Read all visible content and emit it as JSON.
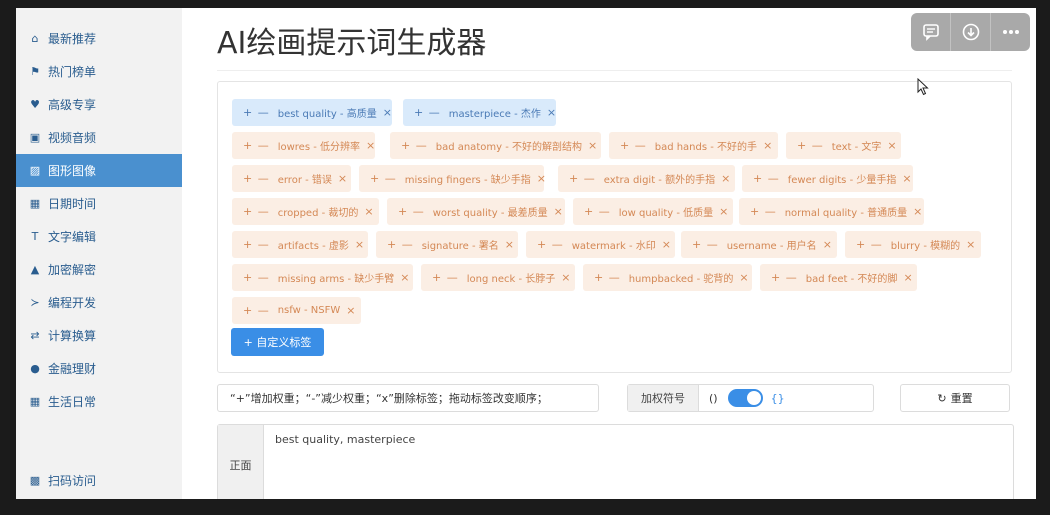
{
  "sidebar": {
    "items": [
      {
        "label": "最新推荐",
        "icon": "home-icon",
        "glyph": "⌂"
      },
      {
        "label": "热门榜单",
        "icon": "flag-icon",
        "glyph": "⚑"
      },
      {
        "label": "高级专享",
        "icon": "heart-icon",
        "glyph": "♥"
      },
      {
        "label": "视频音频",
        "icon": "film-icon",
        "glyph": "▣"
      },
      {
        "label": "图形图像",
        "icon": "image-icon",
        "glyph": "▨"
      },
      {
        "label": "日期时间",
        "icon": "calendar-icon",
        "glyph": "▦"
      },
      {
        "label": "文字编辑",
        "icon": "text-icon",
        "glyph": "T"
      },
      {
        "label": "加密解密",
        "icon": "lock-icon",
        "glyph": "▲"
      },
      {
        "label": "编程开发",
        "icon": "terminal-icon",
        "glyph": "≻"
      },
      {
        "label": "计算换算",
        "icon": "exchange-icon",
        "glyph": "⇄"
      },
      {
        "label": "金融理财",
        "icon": "piggy-bank-icon",
        "glyph": "●"
      },
      {
        "label": "生活日常",
        "icon": "grid-icon",
        "glyph": "▦"
      }
    ],
    "active_index": 4,
    "bottom": {
      "label": "扫码访问",
      "icon": "qr-code-icon",
      "glyph": "▩"
    }
  },
  "page": {
    "title": "AI绘画提示词生成器"
  },
  "tag_controls": {
    "plus_minus": "+ —",
    "remove": "×"
  },
  "selected_tags": [
    "best quality - 高质量",
    "masterpiece - 杰作"
  ],
  "negative_tags": [
    "lowres - 低分辨率",
    "bad anatomy - 不好的解剖结构",
    "bad hands - 不好的手",
    "text - 文字",
    "error - 错误",
    "missing fingers - 缺少手指",
    "extra digit - 额外的手指",
    "fewer digits - 少量手指",
    "cropped - 裁切的",
    "worst quality - 最差质量",
    "low quality - 低质量",
    "normal quality - 普通质量",
    "artifacts - 虚影",
    "signature - 署名",
    "watermark - 水印",
    "username - 用户名",
    "blurry - 模糊的",
    "missing arms - 缺少手臂",
    "long neck - 长脖子",
    "humpbacked - 驼背的",
    "bad feet - 不好的脚",
    "nsfw - NSFW"
  ],
  "custom_tag_button": "+ 自定义标签",
  "hint_text": "“+”增加权重；“-”减少权重；“x”删除标签；拖动标签改变顺序；",
  "weight_symbol": {
    "label": "加权符号",
    "option_left": "()",
    "option_right": "{}",
    "toggled": true
  },
  "reset_button": "重置",
  "output": {
    "side_label": "正面",
    "text": "best quality, masterpiece"
  },
  "colors": {
    "accent": "#3a8ee6",
    "sidebar_active": "#4a90cf",
    "tag_blue_bg": "#d9eafb",
    "tag_orange_bg": "#fbeee4"
  },
  "toolbar_icons": [
    "comment-icon",
    "download-icon",
    "more-icon"
  ]
}
